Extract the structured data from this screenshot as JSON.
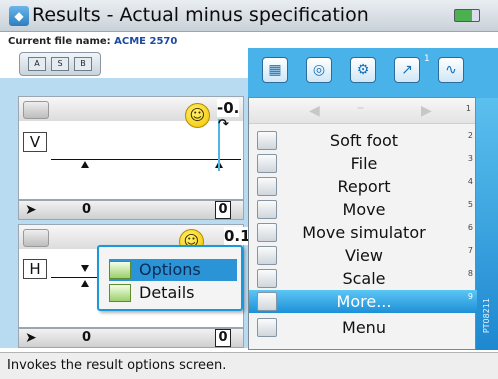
{
  "window": {
    "title": "Results - Actual minus specification"
  },
  "file": {
    "label": "Current file name:",
    "name": "ACME 2570"
  },
  "view_buttons": [
    "A",
    "S",
    "B"
  ],
  "panels": [
    {
      "axis": "V",
      "value": "-0.",
      "status_value_left": "0",
      "status_value_right": "0"
    },
    {
      "axis": "H",
      "value": "0.1",
      "status_value_left": "0",
      "status_value_right": "0"
    }
  ],
  "submenu": {
    "items": [
      {
        "label": "Options",
        "selected": true
      },
      {
        "label": "Details",
        "selected": false
      }
    ]
  },
  "toolbar": {
    "icons": [
      "layout-icon",
      "target-icon",
      "sensor-icon",
      "file-export-icon",
      "wave-icon"
    ],
    "badge": "1"
  },
  "menu": {
    "items": [
      {
        "label": "Soft foot",
        "num": "2"
      },
      {
        "label": "File",
        "num": "3"
      },
      {
        "label": "Report",
        "num": "4"
      },
      {
        "label": "Move",
        "num": "5"
      },
      {
        "label": "Move simulator",
        "num": "6"
      },
      {
        "label": "View",
        "num": "7"
      },
      {
        "label": "Scale",
        "num": "8"
      },
      {
        "label": "More...",
        "num": "9",
        "selected": true
      },
      {
        "label": "Menu",
        "num": ""
      }
    ],
    "top_num": "1"
  },
  "status": {
    "text": "Invokes the result options screen."
  },
  "side_text": "PT08211",
  "colors": {
    "accent": "#49b3e9",
    "selection": "#1d8fd7",
    "main_bg": "#b9dbf1"
  }
}
